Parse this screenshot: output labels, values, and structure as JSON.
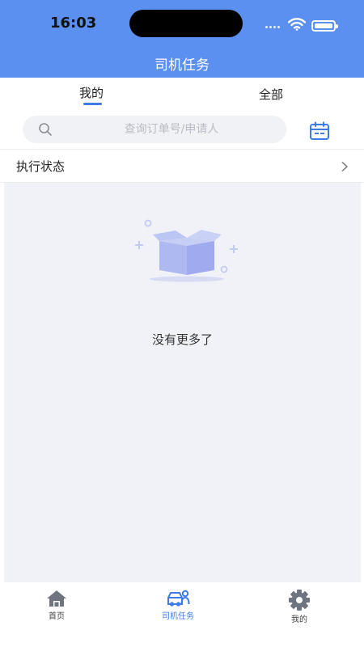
{
  "status_bar": {
    "time": "16:03"
  },
  "header": {
    "title": "司机任务"
  },
  "tabs": [
    {
      "label": "我的",
      "active": true
    },
    {
      "label": "全部",
      "active": false
    }
  ],
  "search": {
    "placeholder": "查询订单号/申请人",
    "value": ""
  },
  "filter": {
    "label": "执行状态"
  },
  "empty_state": {
    "message": "没有更多了"
  },
  "tabbar": [
    {
      "label": "首页",
      "icon": "home-icon",
      "active": false
    },
    {
      "label": "司机任务",
      "icon": "driver-car-icon",
      "active": true
    },
    {
      "label": "我的",
      "icon": "gear-icon",
      "active": false
    }
  ],
  "colors": {
    "header": "#5b8ff0",
    "accent": "#3f7be8",
    "content_bg": "#f1f2f7"
  }
}
